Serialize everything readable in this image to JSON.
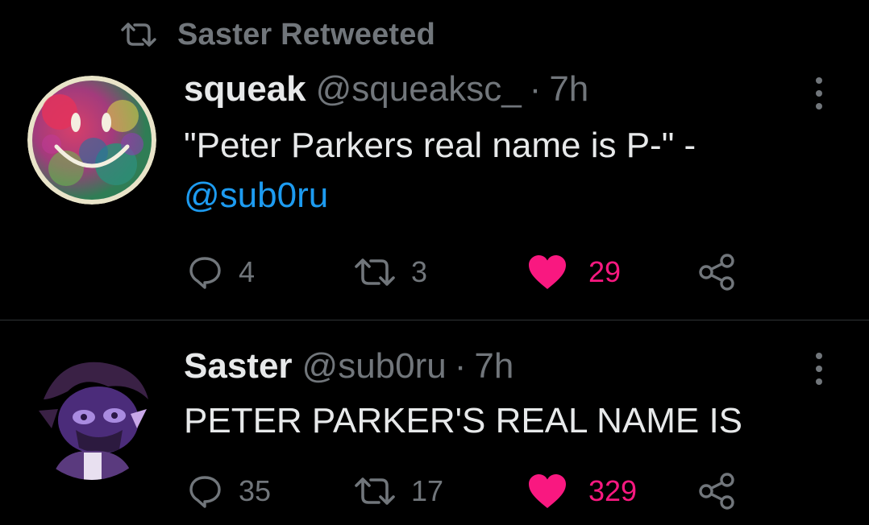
{
  "retweet_banner": {
    "label": "Saster Retweeted",
    "icon": "retweet-icon"
  },
  "tweets": [
    {
      "name": "squeak",
      "handle": "@squeaksc_",
      "separator": "·",
      "time": "7h",
      "text_line1": "\"Peter Parkers real name is P-\" -",
      "mention": "@sub0ru",
      "actions": {
        "replies": "4",
        "retweets": "3",
        "likes": "29"
      }
    },
    {
      "name": "Saster",
      "handle": "@sub0ru",
      "separator": "·",
      "time": "7h",
      "text_line1": "PETER PARKER'S REAL NAME IS",
      "actions": {
        "replies": "35",
        "retweets": "17",
        "likes": "329"
      }
    }
  ],
  "colors": {
    "background": "#000000",
    "text": "#e7e9ea",
    "muted": "#71767b",
    "link": "#1d9bf0",
    "like": "#f91880",
    "divider": "#2f3336"
  }
}
